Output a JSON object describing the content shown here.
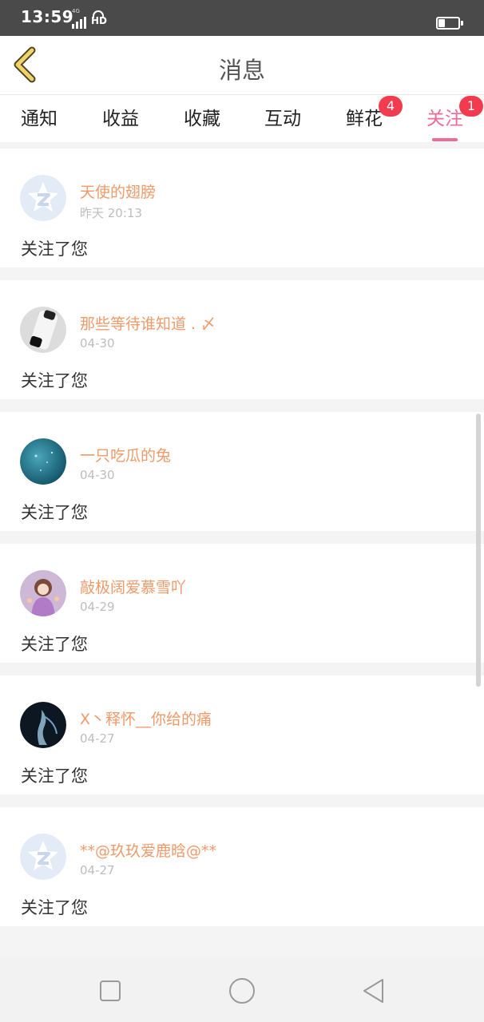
{
  "status": {
    "time": "13:59",
    "network": "4G",
    "hd": "HD",
    "battery_icon": "battery-icon"
  },
  "header": {
    "title": "消息",
    "back_icon": "chevron-left-icon",
    "accent": "#f2d36b"
  },
  "tabs": [
    {
      "label": "通知",
      "badge": null
    },
    {
      "label": "收益",
      "badge": null
    },
    {
      "label": "收藏",
      "badge": null
    },
    {
      "label": "互动",
      "badge": null
    },
    {
      "label": "鲜花",
      "badge": "4"
    },
    {
      "label": "关注",
      "badge": "1"
    }
  ],
  "active_tab": "关注",
  "colors": {
    "accent_pink": "#f06a97",
    "username": "#ef9a6a",
    "badge": "#f23b4f"
  },
  "messages": [
    {
      "user": "天使的翅膀",
      "time": "昨天 20:13",
      "text": "关注了您",
      "avatar": "default-avatar-icon"
    },
    {
      "user": "那些等待谁知道 . 〆",
      "time": "04-30",
      "text": "关注了您",
      "avatar": "photo-avatar"
    },
    {
      "user": "一只吃瓜的兔",
      "time": "04-30",
      "text": "关注了您",
      "avatar": "photo-avatar"
    },
    {
      "user": "敲极阔爱慕雪吖",
      "time": "04-29",
      "text": "关注了您",
      "avatar": "photo-avatar"
    },
    {
      "user": "X丶释怀__你给的痛",
      "time": "04-27",
      "text": "关注了您",
      "avatar": "photo-avatar"
    },
    {
      "user": "**@玖玖爱鹿晗@**",
      "time": "04-27",
      "text": "关注了您",
      "avatar": "default-avatar-icon"
    }
  ],
  "navbar": {
    "recent_icon": "square-icon",
    "home_icon": "circle-icon",
    "back_icon": "triangle-back-icon"
  }
}
